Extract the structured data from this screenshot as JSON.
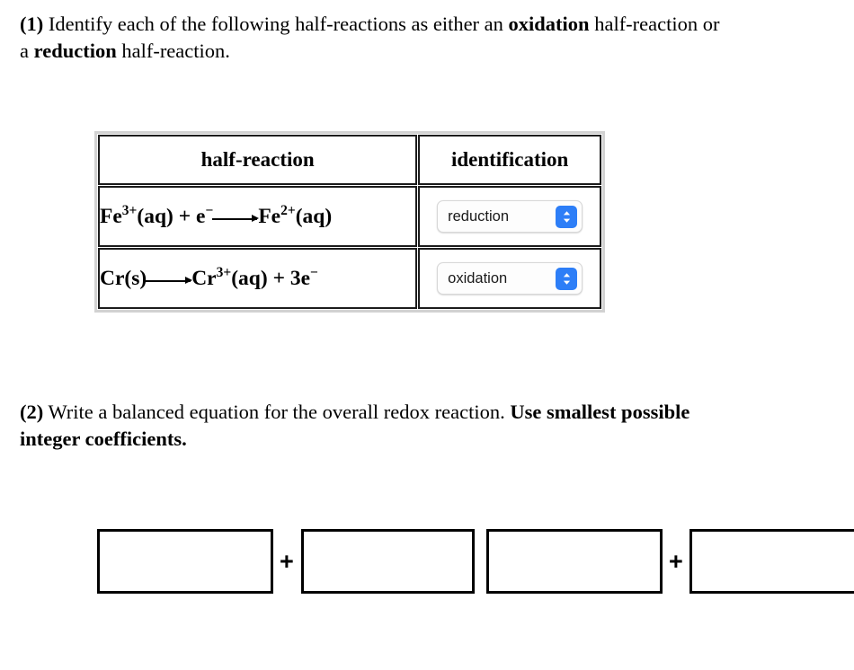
{
  "questions": {
    "q1_number": "(1)",
    "q1_text_part1": " Identify each of the following half-reactions as either an ",
    "q1_bold1": "oxidation",
    "q1_text_part2": " half-reaction or a ",
    "q1_bold2": "reduction",
    "q1_text_part3": " half-reaction.",
    "q2_number": "(2)",
    "q2_text_part1": " Write a balanced equation for the overall redox reaction. ",
    "q2_bold1": "Use smallest possible integer coefficients."
  },
  "table": {
    "headers": {
      "half_reaction": "half-reaction",
      "identification": "identification"
    },
    "rows": [
      {
        "equation": {
          "species1": "Fe",
          "charge1": "3+",
          "state1": "(aq)",
          "plus": " + ",
          "electron": "e",
          "electron_charge": "−",
          "species2": "Fe",
          "charge2": "2+",
          "state2": "(aq)"
        },
        "equation_plain": "Fe3+(aq) + e− ⟶ Fe2+(aq)",
        "selected_value": "reduction",
        "options": [
          "reduction",
          "oxidation"
        ]
      },
      {
        "equation": {
          "species1": "Cr",
          "state1": "(s)",
          "species2": "Cr",
          "charge2": "3+",
          "state2": "(aq)",
          "plus": " + ",
          "coefficient": "3",
          "electron": "e",
          "electron_charge": "−"
        },
        "equation_plain": "Cr(s) ⟶ Cr3+(aq) + 3e−",
        "selected_value": "oxidation",
        "options": [
          "reduction",
          "oxidation"
        ]
      }
    ]
  },
  "answer_area": {
    "boxes": [
      {
        "value": "",
        "placeholder": ""
      },
      {
        "value": "",
        "placeholder": ""
      },
      {
        "value": "",
        "placeholder": ""
      },
      {
        "value": "",
        "placeholder": ""
      }
    ],
    "separator": "+",
    "separator_2": "+"
  },
  "colors": {
    "stepper_blue": "#2d7ef7",
    "table_border": "#1c1c1c",
    "table_outer_frame": "#d2d2d2",
    "answer_box_border": "#000000",
    "text": "#000000",
    "page_background": "#ffffff"
  }
}
